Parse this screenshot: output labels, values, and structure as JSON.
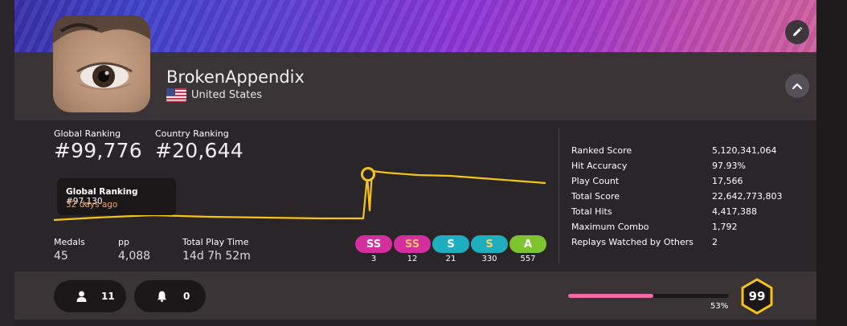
{
  "profile": {
    "username": "BrokenAppendix",
    "country": "United States"
  },
  "rankings": {
    "global_label": "Global Ranking",
    "global_value": "#99,776",
    "country_label": "Country Ranking",
    "country_value": "#20,644"
  },
  "tooltip": {
    "title": "Global Ranking",
    "value": "#97,130",
    "time": "32 days ago"
  },
  "info": {
    "medals_label": "Medals",
    "medals_value": "45",
    "pp_label": "pp",
    "pp_value": "4,088",
    "playtime_label": "Total Play Time",
    "playtime_value": "14d 7h 52m"
  },
  "grades": [
    {
      "label": "SS",
      "count": "3",
      "bg": "#d42e9f",
      "fg": "#ffffff"
    },
    {
      "label": "SS",
      "count": "12",
      "bg": "#d42e9f",
      "fg": "#f7c46b"
    },
    {
      "label": "S",
      "count": "21",
      "bg": "#1eaec0",
      "fg": "#ffffff"
    },
    {
      "label": "S",
      "count": "330",
      "bg": "#1eaec0",
      "fg": "#f7d35a"
    },
    {
      "label": "A",
      "count": "557",
      "bg": "#7ec42e",
      "fg": "#ffffff"
    }
  ],
  "stats": [
    {
      "key": "Ranked Score",
      "value": "5,120,341,064"
    },
    {
      "key": "Hit Accuracy",
      "value": "97.93%"
    },
    {
      "key": "Play Count",
      "value": "17,566"
    },
    {
      "key": "Total Score",
      "value": "22,642,773,803"
    },
    {
      "key": "Total Hits",
      "value": "4,417,388"
    },
    {
      "key": "Maximum Combo",
      "value": "1,792"
    },
    {
      "key": "Replays Watched by Others",
      "value": "2"
    }
  ],
  "social": {
    "friends_count": "11",
    "notifications_count": "0"
  },
  "level": {
    "value": "99",
    "progress_label": "53%",
    "progress_fraction": 0.53
  },
  "colors": {
    "graph_line": "#f6c417",
    "progress_fill": "#f06ba8",
    "level_ring": "#f6c417"
  },
  "icons": {
    "edit": "pencil-icon",
    "collapse": "chevron-up-icon",
    "friends": "user-icon",
    "notifications": "bell-icon",
    "flag": "us-flag-icon"
  }
}
